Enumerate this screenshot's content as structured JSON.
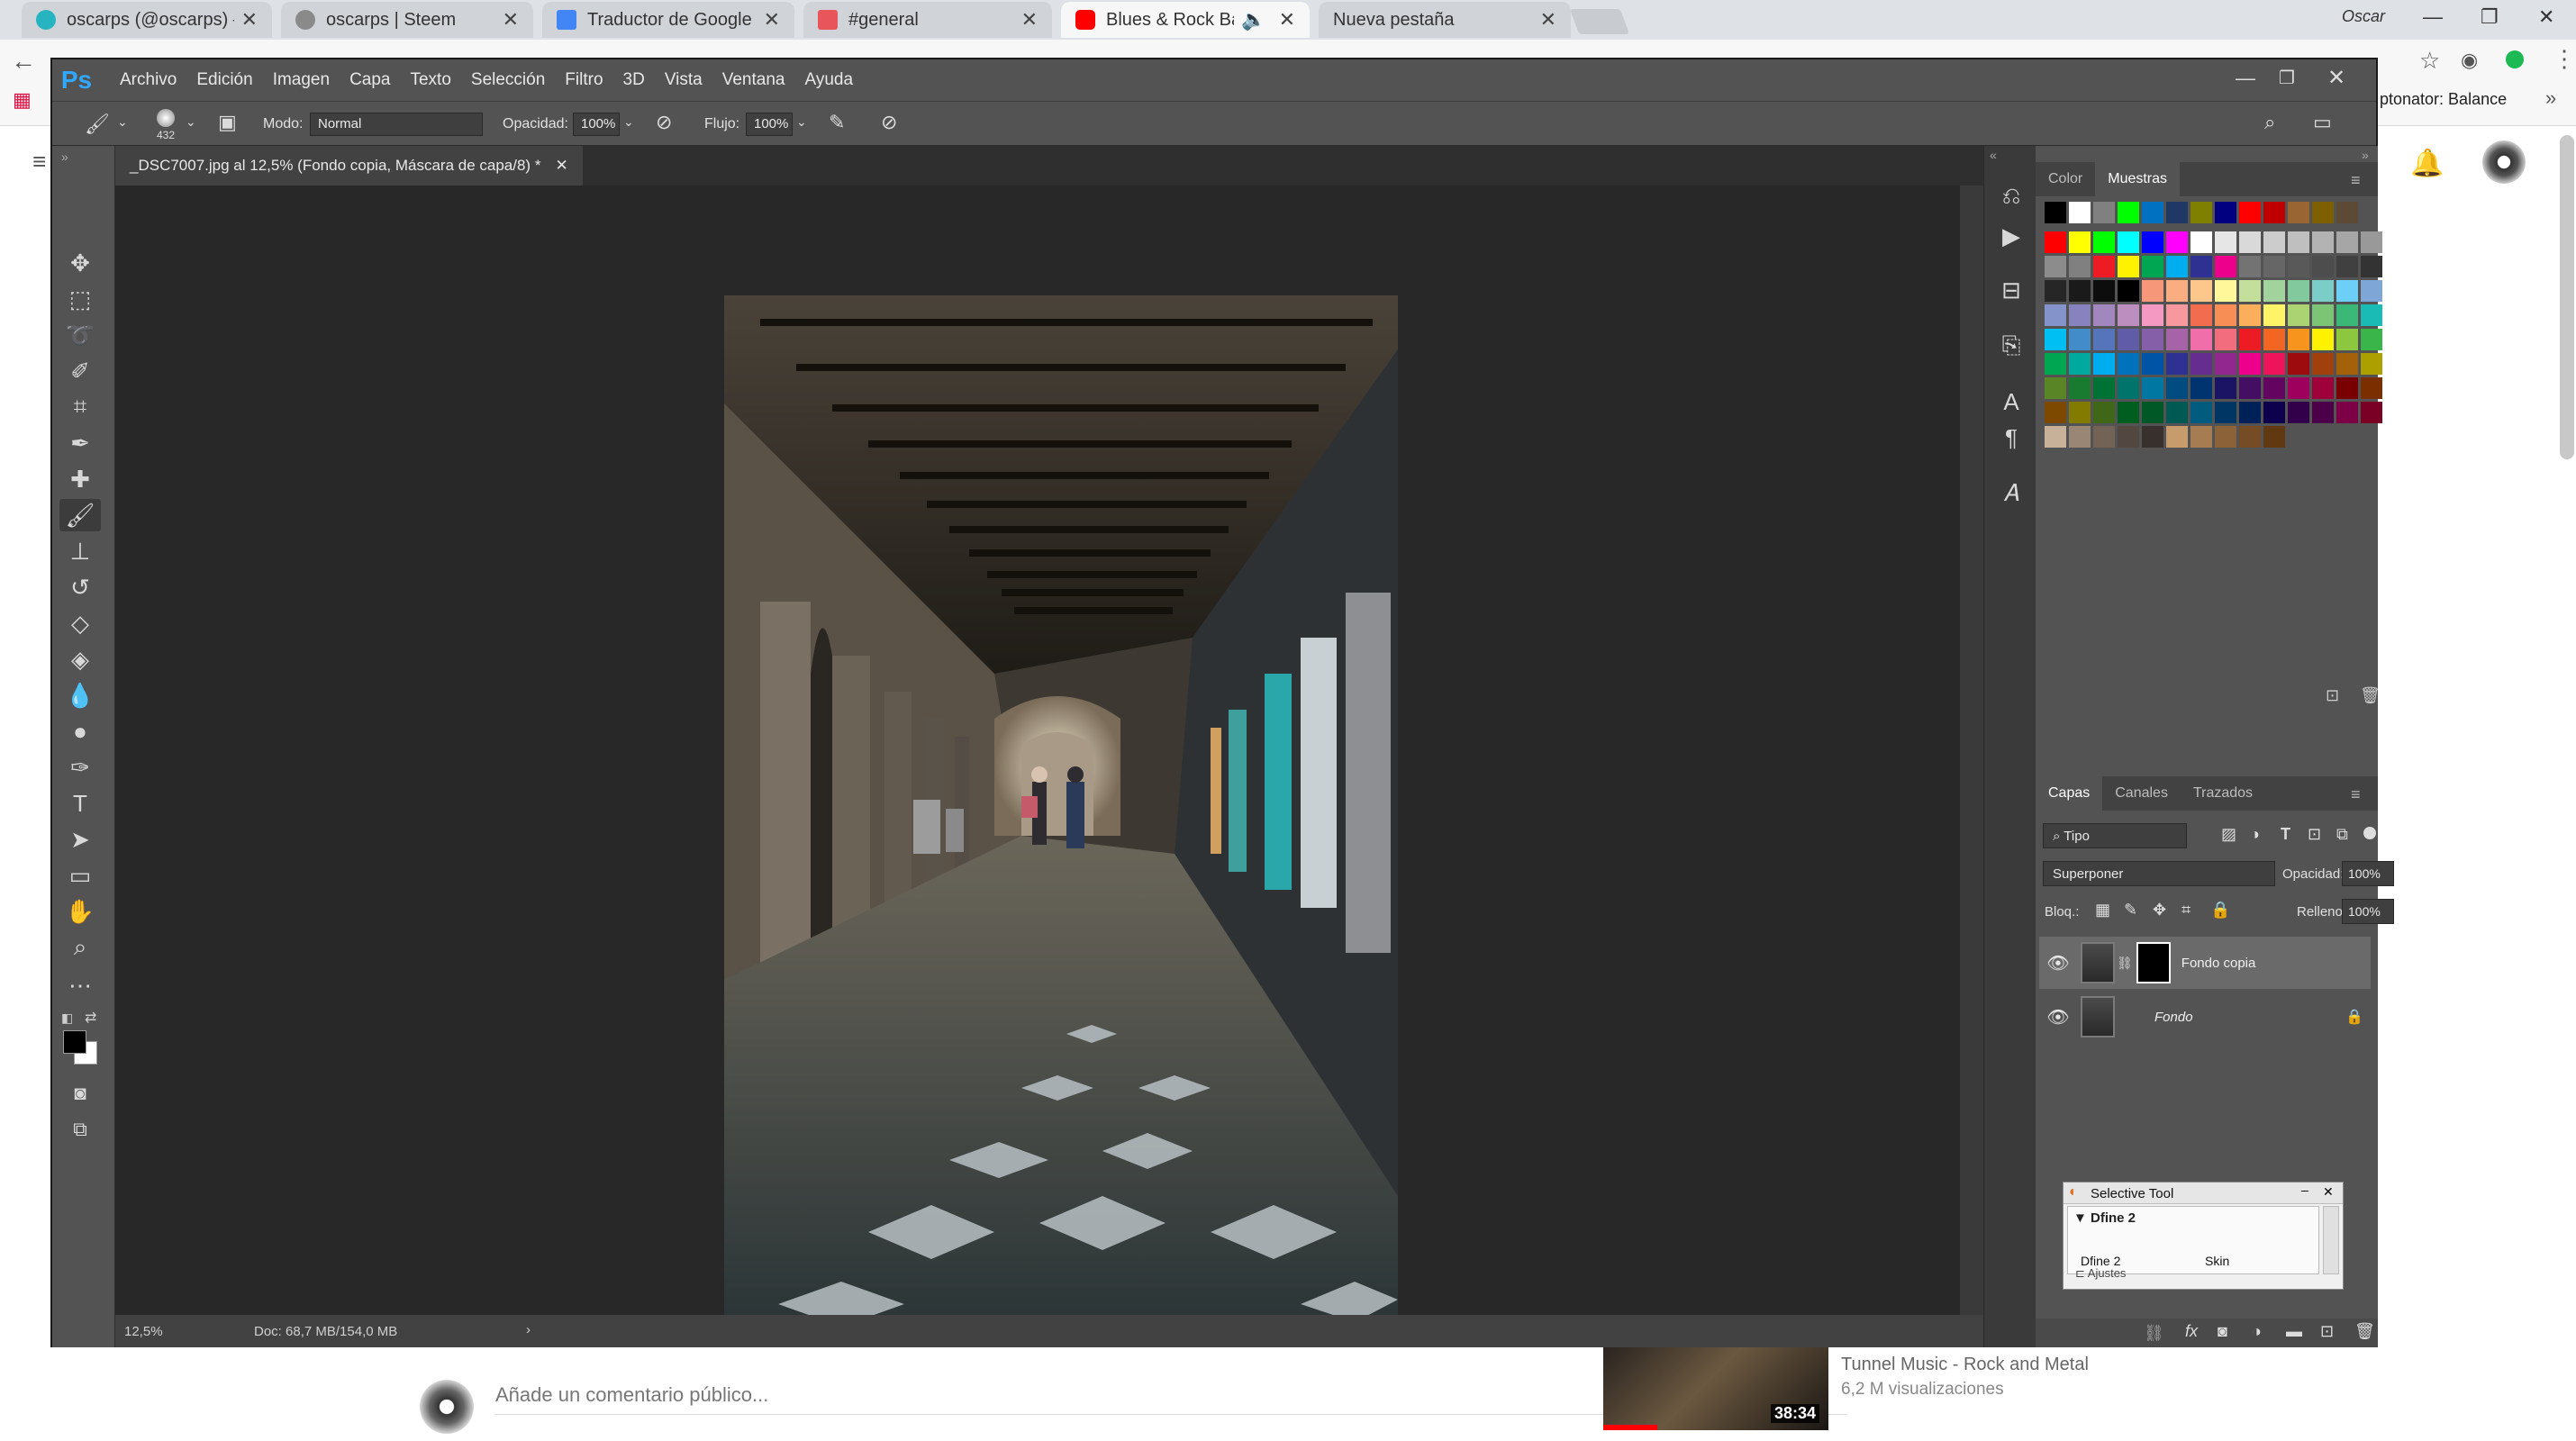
{
  "browser": {
    "tabs": [
      {
        "title": "oscarps (@oscarps) — St",
        "active": false,
        "favicon_color": "#26b5c0"
      },
      {
        "title": "oscarps | Steem",
        "active": false,
        "favicon_color": "#8a8a8a"
      },
      {
        "title": "Traductor de Google",
        "active": false,
        "favicon_color": "#4285f4"
      },
      {
        "title": "#general",
        "active": false,
        "favicon_color": "#e8555b"
      },
      {
        "title": "Blues & Rock Ballads",
        "active": true,
        "favicon_color": "#ff0000"
      },
      {
        "title": "Nueva pestaña",
        "active": false,
        "favicon_color": ""
      }
    ],
    "user_label": "Oscar",
    "extension_text": "ptonator: Balance"
  },
  "ps": {
    "logo": "Ps",
    "menu": [
      "Archivo",
      "Edición",
      "Imagen",
      "Capa",
      "Texto",
      "Selección",
      "Filtro",
      "3D",
      "Vista",
      "Ventana",
      "Ayuda"
    ],
    "options": {
      "brush_size": "432",
      "mode_label": "Modo:",
      "mode_value": "Normal",
      "opacity_label": "Opacidad:",
      "opacity_value": "100%",
      "flow_label": "Flujo:",
      "flow_value": "100%"
    },
    "document_tab": "_DSC7007.jpg al 12,5% (Fondo copia, Máscara de capa/8) *",
    "status": {
      "zoom": "12,5%",
      "doc": "Doc: 68,7 MB/154,0 MB"
    },
    "swatch_panel": {
      "tabs": [
        "Color",
        "Muestras"
      ],
      "active_tab": "Muestras"
    },
    "swatches": {
      "row0": [
        "#000000",
        "#ffffff",
        "#808080",
        "#00ff00",
        "#0070c0",
        "#203864",
        "#808000",
        "#000080",
        "#ff0000",
        "#c00000",
        "#996633",
        "#7f6000",
        "#5c4a36"
      ],
      "row1": [
        "#ff0000",
        "#ffff00",
        "#00ff00",
        "#00ffff",
        "#0000ff",
        "#ff00ff",
        "#ffffff",
        "#e6e6e6",
        "#d9d9d9",
        "#cccccc",
        "#bfbfbf",
        "#b3b3b3",
        "#a6a6a6",
        "#999999"
      ],
      "row2": [
        "#8c8c8c",
        "#808080",
        "#ed1c24",
        "#fff200",
        "#00a651",
        "#00aeef",
        "#2e3192",
        "#ec008c",
        "#737373",
        "#666666",
        "#595959",
        "#4d4d4d",
        "#404040",
        "#333333"
      ],
      "row3": [
        "#262626",
        "#1a1a1a",
        "#0d0d0d",
        "#000000",
        "#f7977a",
        "#f9ad81",
        "#fdc68a",
        "#fff79a",
        "#c4df9b",
        "#a3d39c",
        "#82ca9d",
        "#7bcdc8",
        "#6ecff6",
        "#7ea7d8"
      ],
      "row4": [
        "#8493ca",
        "#8882be",
        "#a187be",
        "#bc8dbf",
        "#f49ac2",
        "#f6989d",
        "#f26c4f",
        "#f68e55",
        "#fbaf5c",
        "#fff467",
        "#acd372",
        "#7cc576",
        "#3bb878",
        "#1abbb4"
      ],
      "row5": [
        "#00bff3",
        "#438cca",
        "#5574b9",
        "#605ca8",
        "#855fa8",
        "#a763a8",
        "#f06eaa",
        "#f26d7d",
        "#ed1c24",
        "#f26522",
        "#f7941d",
        "#fff200",
        "#8dc73f",
        "#39b54a"
      ],
      "row6": [
        "#00a651",
        "#00a99d",
        "#00aeef",
        "#0072bc",
        "#0054a6",
        "#2e3192",
        "#662d91",
        "#92278f",
        "#ec008c",
        "#ed145b",
        "#9e0b0f",
        "#a0410d",
        "#a36209",
        "#aba000"
      ],
      "row7": [
        "#598527",
        "#197b30",
        "#007236",
        "#00746b",
        "#0076a3",
        "#004b80",
        "#003471",
        "#1b1464",
        "#440e62",
        "#630460",
        "#9e005d",
        "#9e0039",
        "#790000",
        "#7b2e00"
      ],
      "row8": [
        "#7d4900",
        "#827b00",
        "#406618",
        "#005e20",
        "#005826",
        "#005952",
        "#005b7f",
        "#003663",
        "#002157",
        "#0d004c",
        "#32004b",
        "#4b0049",
        "#7b0046",
        "#7a0026"
      ],
      "row9": [
        "#c7b299",
        "#998675",
        "#736357",
        "#534741",
        "#37302d",
        "#c69c6d",
        "#a67c52",
        "#8c6239",
        "#754c24",
        "#603913"
      ]
    },
    "layers_panel": {
      "tabs": [
        "Capas",
        "Canales",
        "Trazados"
      ],
      "active_tab": "Capas",
      "filter_label": "Tipo",
      "blend_mode": "Superponer",
      "opacity_label": "Opacidad:",
      "opacity_value": "100%",
      "lock_label": "Bloq.:",
      "fill_label": "Relleno:",
      "fill_value": "100%",
      "layers": [
        {
          "name": "Fondo copia",
          "selected": true,
          "visible": true,
          "has_mask": true
        },
        {
          "name": "Fondo",
          "selected": false,
          "visible": true,
          "locked": true
        }
      ]
    },
    "selective_tool": {
      "title": "Selective Tool",
      "section": "Dfine 2",
      "col1": "Dfine 2",
      "col2": "Skin",
      "footer": "Ajustes"
    }
  },
  "youtube": {
    "comment_placeholder": "Añade un comentario público...",
    "rec_title": "Tunnel Music - Rock and Metal",
    "rec_views": "6,2 M visualizaciones",
    "rec_duration": "38:34"
  }
}
